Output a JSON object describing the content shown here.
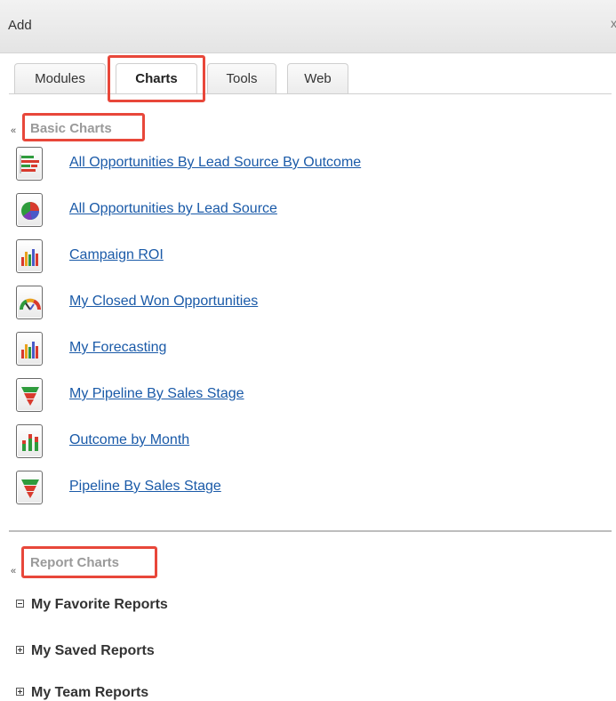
{
  "dialog": {
    "title": "Add",
    "close_label": "x"
  },
  "tabs": [
    {
      "label": "Modules"
    },
    {
      "label": "Charts"
    },
    {
      "label": "Tools"
    },
    {
      "label": "Web"
    }
  ],
  "active_tab": "Charts",
  "basic_charts": {
    "heading": "Basic Charts",
    "items": [
      {
        "label": "All Opportunities By Lead Source By Outcome",
        "icon": "horizontal-bar-chart-icon"
      },
      {
        "label": "All Opportunities by Lead Source",
        "icon": "pie-chart-icon"
      },
      {
        "label": "Campaign ROI",
        "icon": "bar-chart-icon"
      },
      {
        "label": "My Closed Won Opportunities",
        "icon": "gauge-chart-icon"
      },
      {
        "label": "My Forecasting",
        "icon": "bar-chart-icon"
      },
      {
        "label": "My Pipeline By Sales Stage",
        "icon": "funnel-chart-icon"
      },
      {
        "label": "Outcome by Month",
        "icon": "stacked-bar-chart-icon"
      },
      {
        "label": "Pipeline By Sales Stage",
        "icon": "funnel-chart-icon"
      }
    ]
  },
  "report_charts": {
    "heading": "Report Charts",
    "items": [
      {
        "label": "My Favorite Reports",
        "state": "expanded"
      },
      {
        "label": "My Saved Reports",
        "state": "collapsed"
      },
      {
        "label": "My Team Reports",
        "state": "collapsed"
      }
    ]
  },
  "colors": {
    "highlight": "#e8473a",
    "link": "#1a5aa8",
    "heading": "#9a9a9a"
  }
}
